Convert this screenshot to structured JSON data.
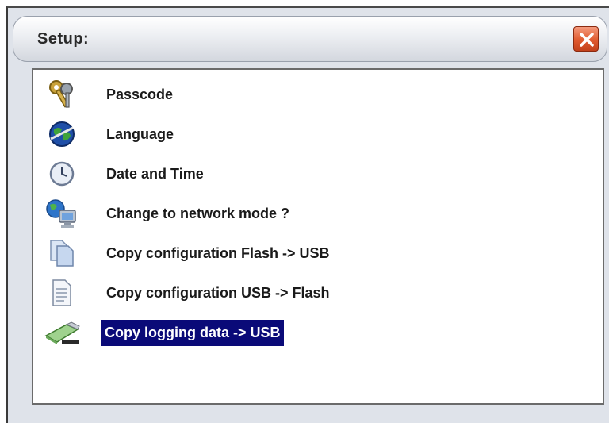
{
  "dialog": {
    "title": "Setup:",
    "close_icon": "close-icon",
    "accent_color": "#0a0a78"
  },
  "items": [
    {
      "label": "Passcode",
      "icon": "keys-icon",
      "selected": false
    },
    {
      "label": "Language",
      "icon": "globe-icon",
      "selected": false
    },
    {
      "label": "Date and Time",
      "icon": "clock-icon",
      "selected": false
    },
    {
      "label": "Change to network mode ?",
      "icon": "network-computer-icon",
      "selected": false
    },
    {
      "label": "Copy configuration Flash -> USB",
      "icon": "copy-pages-icon",
      "selected": false
    },
    {
      "label": "Copy configuration USB -> Flash",
      "icon": "document-icon",
      "selected": false
    },
    {
      "label": "Copy logging data -> USB",
      "icon": "usb-stick-icon",
      "selected": true
    }
  ]
}
